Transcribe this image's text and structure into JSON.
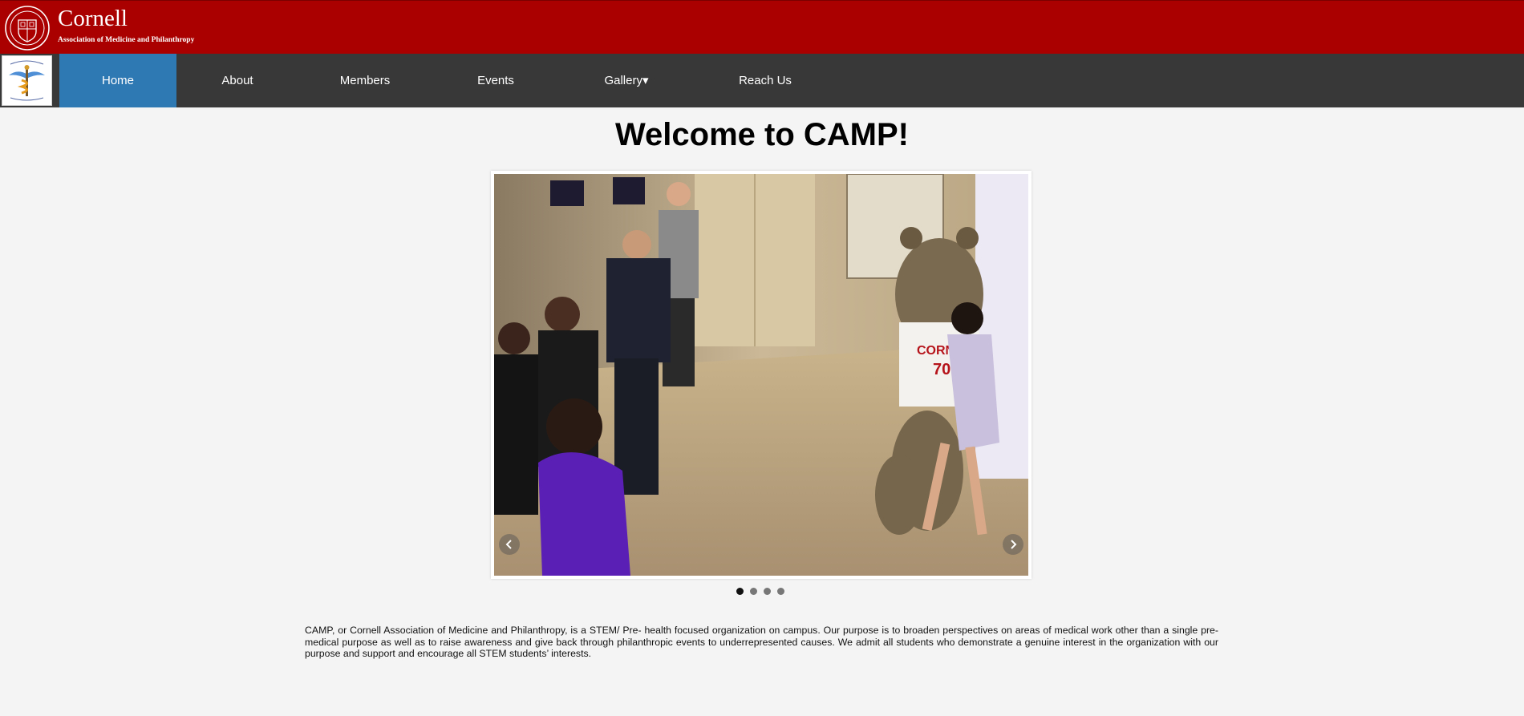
{
  "header": {
    "title": "Cornell",
    "subtitle": "Association of Medicine and Philanthropy",
    "seal_icon": "cornell-seal-icon"
  },
  "nav": {
    "logo_icon": "camp-caduceus-logo-icon",
    "items": [
      {
        "label": "Home",
        "active": true
      },
      {
        "label": "About",
        "active": false
      },
      {
        "label": "Members",
        "active": false
      },
      {
        "label": "Events",
        "active": false
      },
      {
        "label": "Gallery▾",
        "active": false
      },
      {
        "label": "Reach Us",
        "active": false
      }
    ]
  },
  "main": {
    "heading": "Welcome to CAMP!",
    "slideshow": {
      "current_slide": 1,
      "total_slides": 4,
      "prev_icon": "chevron-left-icon",
      "next_icon": "chevron-right-icon"
    },
    "intro": "CAMP, or Cornell Association of Medicine and Philanthropy, is a STEM/ Pre- health focused organization on campus. Our purpose is to broaden perspectives on areas of medical work other than a single pre-medical purpose as well as to raise awareness and give back through philanthropic events to underrepresented causes. We admit all students who demonstrate a genuine interest in the organization with our purpose and support and encourage all STEM students’ interests."
  },
  "colors": {
    "banner": "#aa0000",
    "nav_bg": "#383838",
    "nav_active": "#2e78b3",
    "page_bg": "#f4f4f4"
  }
}
